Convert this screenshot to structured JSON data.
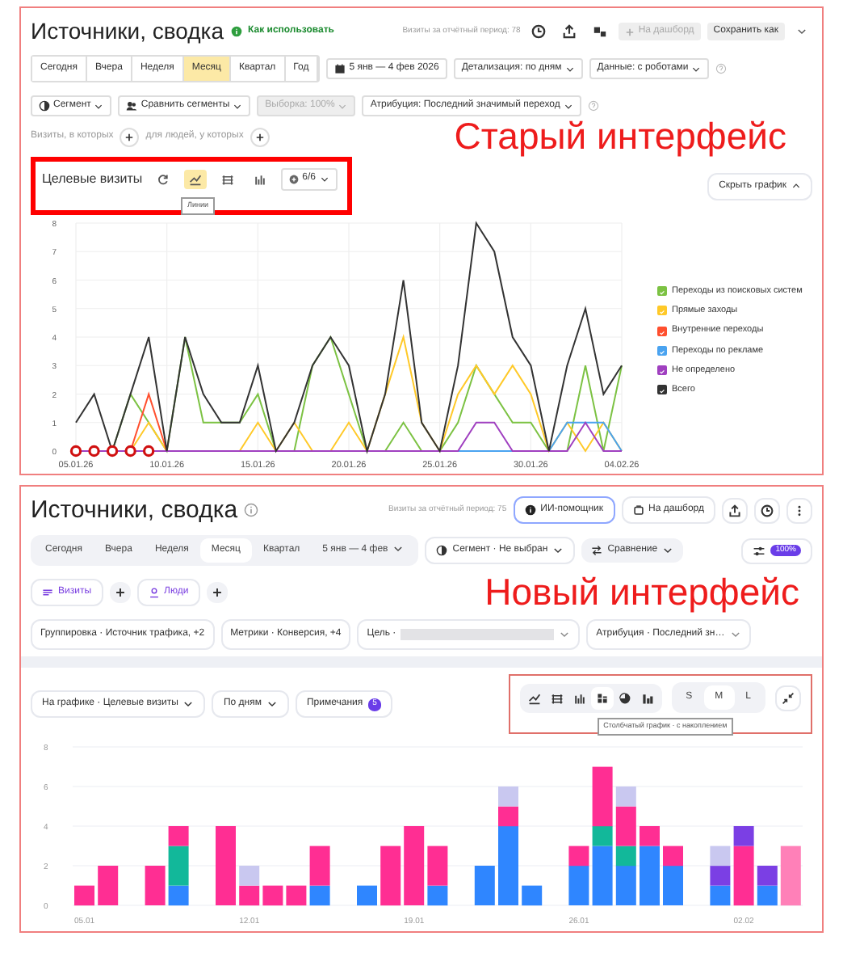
{
  "old": {
    "title": "Источники, сводка",
    "help_link": "Как использовать",
    "visits_total": "Визиты за отчётный период: 78",
    "dashboard": {
      "label": "На дашборд",
      "disabled": true
    },
    "save": "Сохранить как",
    "periods": [
      {
        "label": "Сегодня",
        "selected": false
      },
      {
        "label": "Вчера",
        "selected": false
      },
      {
        "label": "Неделя",
        "selected": false
      },
      {
        "label": "Месяц",
        "selected": true
      },
      {
        "label": "Квартал",
        "selected": false
      },
      {
        "label": "Год",
        "selected": false
      }
    ],
    "date_range": "5 янв — 4 фев 2026",
    "detail": "Детализация: по дням",
    "data_mode": "Данные: с роботами",
    "segment": "Сегмент",
    "compare": "Сравнить сегменты",
    "sample": {
      "label": "Выборка: 100%",
      "disabled": true
    },
    "attribution": "Атрибуция: Последний значимый переход",
    "condition_visits": "Визиты, в которых",
    "condition_people": "для людей, у которых",
    "annotation": "Старый интерфейс",
    "chart_title": "Целевые визиты",
    "chart_types": [
      {
        "kind": "refresh",
        "selected": false
      },
      {
        "kind": "lines",
        "selected": true
      },
      {
        "kind": "area",
        "selected": false
      },
      {
        "kind": "bars",
        "selected": false
      }
    ],
    "series_picker": "6/6",
    "tooltip": "Линии",
    "hide_chart": "Скрыть график",
    "legend": [
      {
        "checked": true
      },
      {
        "checked": true
      },
      {
        "checked": true
      },
      {
        "checked": true
      },
      {
        "checked": true
      },
      {
        "checked": true
      }
    ],
    "chart_data": {
      "type": "line",
      "grid": true,
      "ylim": [
        0,
        8
      ],
      "yticks": [
        0,
        1,
        2,
        3,
        4,
        5,
        6,
        7,
        8
      ],
      "categories": [
        "05.01.26",
        null,
        null,
        null,
        null,
        "10.01.26",
        null,
        null,
        null,
        null,
        "15.01.26",
        null,
        null,
        null,
        null,
        "20.01.26",
        null,
        null,
        null,
        null,
        "25.01.26",
        null,
        null,
        null,
        null,
        "30.01.26",
        null,
        null,
        null,
        null,
        "04.02.26"
      ],
      "series": [
        {
          "name": "Переходы из поисковых систем",
          "color": "#7cc243",
          "values": [
            0,
            0,
            0,
            2,
            1,
            0,
            4,
            1,
            1,
            1,
            2,
            0,
            0,
            3,
            4,
            2,
            0,
            0,
            1,
            0,
            0,
            1,
            3,
            2,
            1,
            1,
            0,
            0,
            3,
            0,
            3
          ]
        },
        {
          "name": "Прямые заходы",
          "color": "#ffc928",
          "values": [
            null,
            null,
            0,
            0,
            1,
            0,
            0,
            0,
            0,
            0,
            1,
            0,
            1,
            0,
            0,
            1,
            0,
            2,
            4,
            1,
            0,
            2,
            3,
            2,
            3,
            2,
            0,
            1,
            0,
            1,
            0
          ]
        },
        {
          "name": "Внутренние переходы",
          "color": "#ff4f2e",
          "values": [
            0,
            0,
            0,
            0,
            2,
            0,
            null,
            null,
            null,
            null,
            null,
            null,
            null,
            null,
            null,
            null,
            null,
            null,
            null,
            null,
            null,
            null,
            null,
            null,
            null,
            null,
            null,
            null,
            null,
            null,
            null
          ]
        },
        {
          "name": "Переходы по рекламе",
          "color": "#4aa3f0",
          "values": [
            null,
            null,
            null,
            null,
            null,
            null,
            null,
            null,
            null,
            null,
            null,
            null,
            null,
            null,
            null,
            null,
            null,
            null,
            null,
            null,
            null,
            0,
            0,
            0,
            0,
            null,
            0,
            1,
            1,
            1,
            0
          ]
        },
        {
          "name": "Не определено",
          "color": "#a040c0",
          "values": [
            0,
            0,
            0,
            0,
            0,
            0,
            0,
            0,
            0,
            0,
            0,
            0,
            0,
            0,
            0,
            0,
            0,
            0,
            0,
            0,
            0,
            0,
            1,
            1,
            0,
            0,
            0,
            0,
            1,
            0,
            0
          ]
        },
        {
          "name": "Всего",
          "color": "#333333",
          "values": [
            1,
            2,
            0,
            2,
            4,
            0,
            4,
            2,
            1,
            1,
            3,
            0,
            1,
            3,
            4,
            3,
            0,
            2,
            6,
            1,
            0,
            3,
            8,
            7,
            4,
            3,
            0,
            3,
            5,
            2,
            3
          ]
        }
      ]
    },
    "day_notes": [
      {
        "marked": true
      },
      {
        "marked": true
      },
      {
        "marked": true
      },
      {
        "marked": true
      },
      {
        "marked": true
      }
    ]
  },
  "new": {
    "title": "Источники, сводка",
    "visits_total": "Визиты за отчётный период: 75",
    "assistant": "ИИ-помощник",
    "dashboard": "На дашборд",
    "periods": [
      {
        "label": "Сегодня",
        "selected": false
      },
      {
        "label": "Вчера",
        "selected": false
      },
      {
        "label": "Неделя",
        "selected": false
      },
      {
        "label": "Месяц",
        "selected": true
      },
      {
        "label": "Квартал",
        "selected": false
      }
    ],
    "date_range": "5 янв — 4 фев",
    "segment": "Сегмент · Не выбран",
    "compare": "Сравнение",
    "sample_badge": "100%",
    "entities": [
      {
        "kind": "visits",
        "label": "Визиты"
      },
      {
        "kind": "people",
        "label": "Люди"
      }
    ],
    "annotation": "Новый интерфейс",
    "filters": [
      {
        "label": "Группировка · Источник трафика, +2",
        "redacted": false,
        "dropdown": false
      },
      {
        "label": "Метрики · Конверсия, +4",
        "redacted": false,
        "dropdown": false
      },
      {
        "label": "Цель ·",
        "redacted": true,
        "dropdown": true
      },
      {
        "label": "Атрибуция · Последний зн…",
        "redacted": false,
        "dropdown": true
      }
    ],
    "chart_selector": "На графике · Целевые визиты",
    "granularity": "По дням",
    "notes": {
      "label": "Примечания",
      "count": "5"
    },
    "chart_types": [
      {
        "kind": "lines",
        "selected": false
      },
      {
        "kind": "area",
        "selected": false
      },
      {
        "kind": "bars",
        "selected": false
      },
      {
        "kind": "stacked",
        "selected": true
      },
      {
        "kind": "pie",
        "selected": false
      },
      {
        "kind": "columns",
        "selected": false
      }
    ],
    "sizes": [
      {
        "label": "S",
        "selected": false
      },
      {
        "label": "M",
        "selected": true
      },
      {
        "label": "L",
        "selected": false
      }
    ],
    "tooltip": "Столбчатый график · с накоплением",
    "chart_data": {
      "type": "bar",
      "stacked": true,
      "grid": true,
      "ylim": [
        0,
        8
      ],
      "yticks": [
        0,
        2,
        4,
        6,
        8
      ],
      "categories": [
        "05.01",
        null,
        null,
        null,
        null,
        null,
        null,
        "12.01",
        null,
        null,
        null,
        null,
        null,
        null,
        "19.01",
        null,
        null,
        null,
        null,
        null,
        null,
        "26.01",
        null,
        null,
        null,
        null,
        null,
        null,
        "02.02",
        null,
        null
      ],
      "series": [
        {
          "color": "#2f86ff",
          "values": [
            0,
            0,
            0,
            0,
            1,
            0,
            0,
            0,
            0,
            0,
            1,
            0,
            1,
            0,
            0,
            1,
            0,
            2,
            4,
            1,
            0,
            2,
            3,
            2,
            3,
            2,
            0,
            1,
            0,
            1,
            0
          ]
        },
        {
          "color": "#12b89a",
          "values": [
            0,
            0,
            0,
            0,
            2,
            0,
            0,
            0,
            0,
            0,
            0,
            0,
            0,
            0,
            0,
            0,
            0,
            0,
            0,
            0,
            0,
            0,
            1,
            1,
            0,
            0,
            0,
            0,
            0,
            0,
            0
          ]
        },
        {
          "color": "#ff2e93",
          "values": [
            1,
            2,
            0,
            2,
            1,
            0,
            4,
            1,
            1,
            1,
            2,
            0,
            0,
            3,
            4,
            2,
            0,
            0,
            1,
            0,
            0,
            1,
            3,
            2,
            1,
            1,
            0,
            0,
            3,
            0,
            0
          ]
        },
        {
          "color": "#7b3fe4",
          "values": [
            0,
            0,
            0,
            0,
            0,
            0,
            0,
            0,
            0,
            0,
            0,
            0,
            0,
            0,
            0,
            0,
            0,
            0,
            0,
            0,
            0,
            0,
            0,
            0,
            0,
            0,
            0,
            1,
            1,
            1,
            0
          ]
        },
        {
          "color": "#c9c8f0",
          "values": [
            0,
            0,
            0,
            0,
            0,
            0,
            0,
            1,
            0,
            0,
            0,
            0,
            0,
            0,
            0,
            0,
            0,
            0,
            1,
            0,
            0,
            0,
            0,
            1,
            0,
            0,
            0,
            1,
            0,
            0,
            0
          ]
        },
        {
          "color": "#ff80b8",
          "values": [
            0,
            0,
            0,
            0,
            0,
            0,
            0,
            0,
            0,
            0,
            0,
            0,
            0,
            0,
            0,
            0,
            0,
            0,
            0,
            0,
            0,
            0,
            0,
            0,
            0,
            0,
            0,
            0,
            0,
            0,
            3
          ]
        }
      ]
    }
  }
}
